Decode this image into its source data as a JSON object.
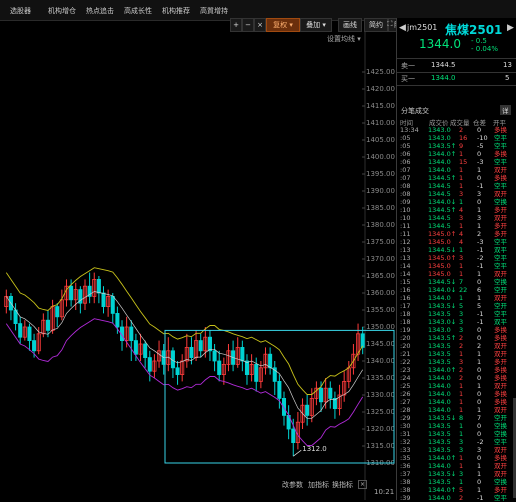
{
  "top_tabs": [
    "选股器",
    "机构增仓",
    "热点追击",
    "高成长性",
    "机构推荐",
    "高質增持"
  ],
  "toolbar": {
    "plus": "+",
    "minus": "−",
    "close": "×",
    "fuquan": "复权",
    "overlay": "叠加",
    "draw": "画线",
    "simple": "简约",
    "hide": "隐藏",
    "prev": "◂",
    "next": "▸",
    "fullscreen": "⛶",
    "settings_label": "设置均线"
  },
  "price_axis": [
    "1425.00",
    "1420.00",
    "1415.00",
    "1410.00",
    "1405.00",
    "1400.00",
    "1395.00",
    "1390.00",
    "1385.00",
    "1380.00",
    "1375.00",
    "1370.00",
    "1365.00",
    "1360.00",
    "1355.00",
    "1350.00",
    "1345.00",
    "1340.00",
    "1335.00",
    "1330.00",
    "1325.00",
    "1320.00",
    "1315.00",
    "1310.00"
  ],
  "chart": {
    "low_label": "1312.0",
    "time_label": "10:21",
    "bottom_buttons": [
      "改参数",
      "加指标",
      "换指标"
    ],
    "colors": {
      "up": "#ff3b3b",
      "down": "#00d2d2",
      "band": "#c8c21a",
      "lower": "#b02ad8",
      "box": "#39d5e8"
    },
    "candles": [
      {
        "o": 1356,
        "c": 1359,
        "h": 1361,
        "l": 1354
      },
      {
        "o": 1359,
        "c": 1355,
        "h": 1360,
        "l": 1352
      },
      {
        "o": 1355,
        "c": 1351,
        "h": 1357,
        "l": 1349
      },
      {
        "o": 1351,
        "c": 1347,
        "h": 1353,
        "l": 1345
      },
      {
        "o": 1347,
        "c": 1350,
        "h": 1352,
        "l": 1346
      },
      {
        "o": 1350,
        "c": 1346,
        "h": 1351,
        "l": 1343
      },
      {
        "o": 1346,
        "c": 1343,
        "h": 1348,
        "l": 1341
      },
      {
        "o": 1343,
        "c": 1348,
        "h": 1350,
        "l": 1342
      },
      {
        "o": 1348,
        "c": 1352,
        "h": 1354,
        "l": 1347
      },
      {
        "o": 1352,
        "c": 1349,
        "h": 1355,
        "l": 1347
      },
      {
        "o": 1349,
        "c": 1356,
        "h": 1358,
        "l": 1348
      },
      {
        "o": 1356,
        "c": 1353,
        "h": 1357,
        "l": 1350
      },
      {
        "o": 1353,
        "c": 1358,
        "h": 1361,
        "l": 1352
      },
      {
        "o": 1358,
        "c": 1362,
        "h": 1364,
        "l": 1356
      },
      {
        "o": 1362,
        "c": 1358,
        "h": 1364,
        "l": 1356
      },
      {
        "o": 1358,
        "c": 1361,
        "h": 1363,
        "l": 1355
      },
      {
        "o": 1361,
        "c": 1357,
        "h": 1362,
        "l": 1354
      },
      {
        "o": 1357,
        "c": 1362,
        "h": 1364,
        "l": 1355
      },
      {
        "o": 1362,
        "c": 1359,
        "h": 1366,
        "l": 1357
      },
      {
        "o": 1359,
        "c": 1364,
        "h": 1366,
        "l": 1357
      },
      {
        "o": 1364,
        "c": 1360,
        "h": 1365,
        "l": 1357
      },
      {
        "o": 1360,
        "c": 1356,
        "h": 1362,
        "l": 1354
      },
      {
        "o": 1356,
        "c": 1359,
        "h": 1361,
        "l": 1353
      },
      {
        "o": 1359,
        "c": 1354,
        "h": 1360,
        "l": 1351
      },
      {
        "o": 1354,
        "c": 1350,
        "h": 1356,
        "l": 1348
      },
      {
        "o": 1350,
        "c": 1346,
        "h": 1352,
        "l": 1343
      },
      {
        "o": 1346,
        "c": 1350,
        "h": 1353,
        "l": 1344
      },
      {
        "o": 1350,
        "c": 1346,
        "h": 1352,
        "l": 1340
      },
      {
        "o": 1346,
        "c": 1342,
        "h": 1348,
        "l": 1340
      },
      {
        "o": 1342,
        "c": 1345,
        "h": 1348,
        "l": 1340
      },
      {
        "o": 1345,
        "c": 1341,
        "h": 1346,
        "l": 1338
      },
      {
        "o": 1341,
        "c": 1337,
        "h": 1343,
        "l": 1334
      },
      {
        "o": 1337,
        "c": 1340,
        "h": 1342,
        "l": 1335
      },
      {
        "o": 1340,
        "c": 1343,
        "h": 1346,
        "l": 1338
      },
      {
        "o": 1343,
        "c": 1339,
        "h": 1345,
        "l": 1336
      },
      {
        "o": 1339,
        "c": 1343,
        "h": 1347,
        "l": 1337
      },
      {
        "o": 1343,
        "c": 1338,
        "h": 1344,
        "l": 1335
      },
      {
        "o": 1338,
        "c": 1336,
        "h": 1340,
        "l": 1333
      },
      {
        "o": 1336,
        "c": 1340,
        "h": 1342,
        "l": 1334
      },
      {
        "o": 1340,
        "c": 1344,
        "h": 1348,
        "l": 1338
      },
      {
        "o": 1344,
        "c": 1341,
        "h": 1347,
        "l": 1339
      },
      {
        "o": 1341,
        "c": 1346,
        "h": 1349,
        "l": 1340
      },
      {
        "o": 1346,
        "c": 1343,
        "h": 1348,
        "l": 1341
      },
      {
        "o": 1343,
        "c": 1347,
        "h": 1350,
        "l": 1341
      },
      {
        "o": 1347,
        "c": 1343,
        "h": 1349,
        "l": 1340
      },
      {
        "o": 1343,
        "c": 1340,
        "h": 1345,
        "l": 1337
      },
      {
        "o": 1340,
        "c": 1336,
        "h": 1343,
        "l": 1334
      },
      {
        "o": 1336,
        "c": 1339,
        "h": 1341,
        "l": 1333
      },
      {
        "o": 1339,
        "c": 1343,
        "h": 1345,
        "l": 1337
      },
      {
        "o": 1343,
        "c": 1339,
        "h": 1346,
        "l": 1337
      },
      {
        "o": 1339,
        "c": 1344,
        "h": 1347,
        "l": 1338
      },
      {
        "o": 1344,
        "c": 1340,
        "h": 1346,
        "l": 1337
      },
      {
        "o": 1340,
        "c": 1336,
        "h": 1342,
        "l": 1333
      },
      {
        "o": 1336,
        "c": 1339,
        "h": 1342,
        "l": 1334
      },
      {
        "o": 1339,
        "c": 1334,
        "h": 1341,
        "l": 1331
      },
      {
        "o": 1334,
        "c": 1338,
        "h": 1340,
        "l": 1332
      },
      {
        "o": 1338,
        "c": 1342,
        "h": 1344,
        "l": 1336
      },
      {
        "o": 1342,
        "c": 1338,
        "h": 1344,
        "l": 1336
      },
      {
        "o": 1338,
        "c": 1334,
        "h": 1340,
        "l": 1330
      },
      {
        "o": 1334,
        "c": 1329,
        "h": 1336,
        "l": 1326
      },
      {
        "o": 1329,
        "c": 1324,
        "h": 1331,
        "l": 1321
      },
      {
        "o": 1324,
        "c": 1320,
        "h": 1327,
        "l": 1317
      },
      {
        "o": 1320,
        "c": 1316,
        "h": 1323,
        "l": 1312
      },
      {
        "o": 1316,
        "c": 1322,
        "h": 1325,
        "l": 1314
      },
      {
        "o": 1322,
        "c": 1327,
        "h": 1329,
        "l": 1320
      },
      {
        "o": 1327,
        "c": 1324,
        "h": 1330,
        "l": 1321
      },
      {
        "o": 1324,
        "c": 1329,
        "h": 1332,
        "l": 1322
      },
      {
        "o": 1329,
        "c": 1332,
        "h": 1334,
        "l": 1327
      },
      {
        "o": 1332,
        "c": 1328,
        "h": 1334,
        "l": 1325
      },
      {
        "o": 1328,
        "c": 1332,
        "h": 1335,
        "l": 1326
      },
      {
        "o": 1332,
        "c": 1329,
        "h": 1334,
        "l": 1326
      },
      {
        "o": 1329,
        "c": 1326,
        "h": 1331,
        "l": 1323
      },
      {
        "o": 1326,
        "c": 1330,
        "h": 1333,
        "l": 1324
      },
      {
        "o": 1330,
        "c": 1334,
        "h": 1337,
        "l": 1328
      },
      {
        "o": 1334,
        "c": 1338,
        "h": 1340,
        "l": 1332
      },
      {
        "o": 1338,
        "c": 1342,
        "h": 1345,
        "l": 1336
      },
      {
        "o": 1342,
        "c": 1348,
        "h": 1351,
        "l": 1340
      },
      {
        "o": 1348,
        "c": 1344,
        "h": 1350,
        "l": 1342
      }
    ]
  },
  "symbol": {
    "code": "jm2501",
    "name": "焦煤2501",
    "left_arrow": "◀",
    "right_arrow": "▶"
  },
  "quote": {
    "last": "1344.0",
    "change": "- 0.5",
    "change_pct": "- 0.04%"
  },
  "orderbook": [
    {
      "label": "卖一",
      "price": "1344.5",
      "vol": "13"
    },
    {
      "label": "买一",
      "price": "1344.0",
      "vol": "5"
    }
  ],
  "trades": {
    "title": "分笔成交",
    "btn": "详",
    "columns": [
      "时间",
      "成交价",
      "成交量",
      "仓差",
      "开平"
    ],
    "rows": [
      {
        "t": "13:34",
        "p": "1343.0",
        "pc": "green",
        "v": "2",
        "vc": "red",
        "d": "0",
        "k": "多换",
        "kc": "red"
      },
      {
        "t": ":05",
        "p": "1343.0",
        "pc": "green",
        "v": "16",
        "vc": "red",
        "d": "-10",
        "k": "空平",
        "kc": "green"
      },
      {
        "t": ":05",
        "p": "1343.5↑",
        "pc": "green",
        "v": "9",
        "vc": "red",
        "d": "-5",
        "k": "空平",
        "kc": "green"
      },
      {
        "t": ":06",
        "p": "1344.0↑",
        "pc": "green",
        "v": "1",
        "vc": "red",
        "d": "0",
        "k": "多换",
        "kc": "red"
      },
      {
        "t": ":06",
        "p": "1344.0",
        "pc": "green",
        "v": "15",
        "vc": "red",
        "d": "-3",
        "k": "空平",
        "kc": "green"
      },
      {
        "t": ":07",
        "p": "1344.0",
        "pc": "green",
        "v": "1",
        "vc": "red",
        "d": "1",
        "k": "双开",
        "kc": "red"
      },
      {
        "t": ":07",
        "p": "1344.5↑",
        "pc": "green",
        "v": "1",
        "vc": "red",
        "d": "0",
        "k": "多换",
        "kc": "red"
      },
      {
        "t": ":08",
        "p": "1344.5",
        "pc": "green",
        "v": "1",
        "vc": "red",
        "d": "-1",
        "k": "空平",
        "kc": "green"
      },
      {
        "t": ":08",
        "p": "1344.5",
        "pc": "green",
        "v": "3",
        "vc": "red",
        "d": "3",
        "k": "双开",
        "kc": "red"
      },
      {
        "t": ":09",
        "p": "1344.0↓",
        "pc": "green",
        "v": "1",
        "vc": "green",
        "d": "0",
        "k": "空换",
        "kc": "green"
      },
      {
        "t": ":10",
        "p": "1344.5↑",
        "pc": "green",
        "v": "4",
        "vc": "red",
        "d": "1",
        "k": "多开",
        "kc": "red"
      },
      {
        "t": ":10",
        "p": "1344.5",
        "pc": "green",
        "v": "3",
        "vc": "red",
        "d": "3",
        "k": "双开",
        "kc": "red"
      },
      {
        "t": ":11",
        "p": "1344.5",
        "pc": "green",
        "v": "1",
        "vc": "red",
        "d": "1",
        "k": "多开",
        "kc": "red"
      },
      {
        "t": ":11",
        "p": "1345.0↑",
        "pc": "red",
        "v": "4",
        "vc": "red",
        "d": "2",
        "k": "多开",
        "kc": "red"
      },
      {
        "t": ":12",
        "p": "1345.0",
        "pc": "red",
        "v": "4",
        "vc": "red",
        "d": "-3",
        "k": "空平",
        "kc": "green"
      },
      {
        "t": ":13",
        "p": "1344.5↓",
        "pc": "green",
        "v": "1",
        "vc": "green",
        "d": "-1",
        "k": "双平",
        "kc": "green"
      },
      {
        "t": ":13",
        "p": "1345.0↑",
        "pc": "red",
        "v": "3",
        "vc": "red",
        "d": "-2",
        "k": "空平",
        "kc": "green"
      },
      {
        "t": ":14",
        "p": "1345.0",
        "pc": "red",
        "v": "1",
        "vc": "red",
        "d": "-1",
        "k": "空平",
        "kc": "green"
      },
      {
        "t": ":14",
        "p": "1345.0",
        "pc": "red",
        "v": "1",
        "vc": "red",
        "d": "1",
        "k": "双开",
        "kc": "red"
      },
      {
        "t": ":15",
        "p": "1344.5↓",
        "pc": "green",
        "v": "7",
        "vc": "green",
        "d": "0",
        "k": "空换",
        "kc": "green"
      },
      {
        "t": ":16",
        "p": "1344.0↓",
        "pc": "green",
        "v": "22",
        "vc": "green",
        "d": "6",
        "k": "空开",
        "kc": "green"
      },
      {
        "t": ":16",
        "p": "1344.0",
        "pc": "green",
        "v": "1",
        "vc": "green",
        "d": "1",
        "k": "双开",
        "kc": "red"
      },
      {
        "t": ":17",
        "p": "1343.5↓",
        "pc": "green",
        "v": "5",
        "vc": "green",
        "d": "5",
        "k": "空开",
        "kc": "green"
      },
      {
        "t": ":18",
        "p": "1343.5",
        "pc": "green",
        "v": "3",
        "vc": "green",
        "d": "-1",
        "k": "空平",
        "kc": "green"
      },
      {
        "t": ":18",
        "p": "1343.0↓",
        "pc": "green",
        "v": "3",
        "vc": "green",
        "d": "-1",
        "k": "双平",
        "kc": "green"
      },
      {
        "t": ":19",
        "p": "1343.0",
        "pc": "green",
        "v": "3",
        "vc": "green",
        "d": "0",
        "k": "多换",
        "kc": "red"
      },
      {
        "t": ":20",
        "p": "1343.5↑",
        "pc": "green",
        "v": "2",
        "vc": "red",
        "d": "0",
        "k": "多换",
        "kc": "red"
      },
      {
        "t": ":20",
        "p": "1343.5",
        "pc": "green",
        "v": "2",
        "vc": "red",
        "d": "2",
        "k": "双开",
        "kc": "red"
      },
      {
        "t": ":21",
        "p": "1343.5",
        "pc": "green",
        "v": "1",
        "vc": "red",
        "d": "1",
        "k": "双开",
        "kc": "red"
      },
      {
        "t": ":22",
        "p": "1343.5",
        "pc": "green",
        "v": "3",
        "vc": "red",
        "d": "1",
        "k": "多开",
        "kc": "red"
      },
      {
        "t": ":23",
        "p": "1344.0↑",
        "pc": "green",
        "v": "2",
        "vc": "red",
        "d": "0",
        "k": "多换",
        "kc": "red"
      },
      {
        "t": ":24",
        "p": "1344.0",
        "pc": "green",
        "v": "2",
        "vc": "red",
        "d": "0",
        "k": "多换",
        "kc": "red"
      },
      {
        "t": ":25",
        "p": "1344.0",
        "pc": "green",
        "v": "1",
        "vc": "red",
        "d": "1",
        "k": "双开",
        "kc": "red"
      },
      {
        "t": ":26",
        "p": "1344.0",
        "pc": "green",
        "v": "1",
        "vc": "red",
        "d": "0",
        "k": "多换",
        "kc": "red"
      },
      {
        "t": ":27",
        "p": "1344.0",
        "pc": "green",
        "v": "1",
        "vc": "red",
        "d": "0",
        "k": "多换",
        "kc": "red"
      },
      {
        "t": ":28",
        "p": "1344.0",
        "pc": "green",
        "v": "1",
        "vc": "red",
        "d": "1",
        "k": "双开",
        "kc": "red"
      },
      {
        "t": ":29",
        "p": "1343.5↓",
        "pc": "green",
        "v": "8",
        "vc": "green",
        "d": "7",
        "k": "空开",
        "kc": "green"
      },
      {
        "t": ":30",
        "p": "1343.5",
        "pc": "green",
        "v": "1",
        "vc": "green",
        "d": "0",
        "k": "空换",
        "kc": "green"
      },
      {
        "t": ":31",
        "p": "1343.5",
        "pc": "green",
        "v": "1",
        "vc": "green",
        "d": "0",
        "k": "空换",
        "kc": "green"
      },
      {
        "t": ":32",
        "p": "1343.5",
        "pc": "green",
        "v": "3",
        "vc": "green",
        "d": "-2",
        "k": "空平",
        "kc": "green"
      },
      {
        "t": ":33",
        "p": "1343.5",
        "pc": "green",
        "v": "3",
        "vc": "green",
        "d": "3",
        "k": "双开",
        "kc": "red"
      },
      {
        "t": ":35",
        "p": "1344.0↑",
        "pc": "green",
        "v": "1",
        "vc": "red",
        "d": "0",
        "k": "多换",
        "kc": "red"
      },
      {
        "t": ":36",
        "p": "1344.0",
        "pc": "green",
        "v": "1",
        "vc": "red",
        "d": "1",
        "k": "双开",
        "kc": "red"
      },
      {
        "t": ":37",
        "p": "1343.5↓",
        "pc": "green",
        "v": "3",
        "vc": "green",
        "d": "1",
        "k": "双开",
        "kc": "red"
      },
      {
        "t": ":38",
        "p": "1343.5",
        "pc": "green",
        "v": "1",
        "vc": "green",
        "d": "0",
        "k": "空换",
        "kc": "green"
      },
      {
        "t": ":38",
        "p": "1344.0↑",
        "pc": "green",
        "v": "5",
        "vc": "red",
        "d": "1",
        "k": "多开",
        "kc": "red"
      },
      {
        "t": ":39",
        "p": "1344.0",
        "pc": "green",
        "v": "2",
        "vc": "red",
        "d": "-1",
        "k": "空平",
        "kc": "green"
      }
    ]
  }
}
